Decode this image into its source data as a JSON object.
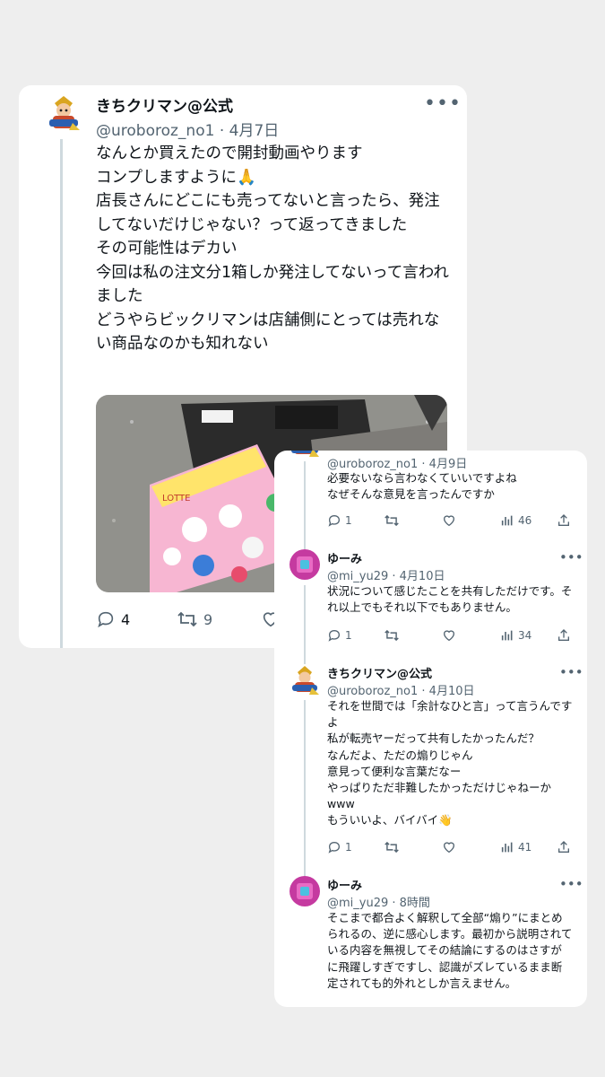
{
  "main_tweet": {
    "display_name": "きちクリマン@公式",
    "handle": "@uroboroz_no1",
    "date": "4月7日",
    "text": "なんとか買えたので開封動画やります\nコンプしますように🙏\n店長さんにどこにも売ってないと言ったら、発注してないだけじゃない？って返ってきました\nその可能性はデカい\n今回は私の注文分1箱しか発注してないって言われました\nどうやらビックリマンは店舗側にとっては売れない商品なのかも知れない",
    "replies": "4",
    "retweets": "9"
  },
  "thread": [
    {
      "handle": "@uroboroz_no1",
      "date": "4月9日",
      "text": "必要ないなら言わなくていいですよね\nなぜそんな意見を言ったんですか",
      "replies": "1",
      "views": "46"
    },
    {
      "display_name": "ゆーみ",
      "handle": "@mi_yu29",
      "date": "4月10日",
      "text": "状況について感じたことを共有しただけです。それ以上でもそれ以下でもありません。",
      "replies": "1",
      "views": "34"
    },
    {
      "display_name": "きちクリマン@公式",
      "handle": "@uroboroz_no1",
      "date": "4月10日",
      "text": "それを世間では「余計なひと言」って言うんですよ\n私が転売ヤーだって共有したかったんだ？\nなんだよ、ただの煽りじゃん\n意見って便利な言葉だなー\nやっぱりただ非難したかっただけじゃねーか\nwww\nもういいよ、バイバイ👋",
      "replies": "1",
      "views": "41"
    },
    {
      "display_name": "ゆーみ",
      "handle": "@mi_yu29",
      "date": "8時間",
      "text": "そこまで都合よく解釈して全部“煽り”にまとめられるの、逆に感心します。最初から説明されている内容を無視してその結論にするのはさすがに飛躍しすぎですし、認識がズレているまま断定されても的外れとしか言えません。"
    }
  ],
  "product_box_text": "LOTTE",
  "colors": {
    "text": "#0f1419",
    "secondary": "#536471",
    "thread_line": "#cfd9de",
    "background": "#eeeeee"
  },
  "icons": [
    "more-icon",
    "reply-icon",
    "retweet-icon",
    "like-icon",
    "views-icon",
    "share-icon"
  ]
}
